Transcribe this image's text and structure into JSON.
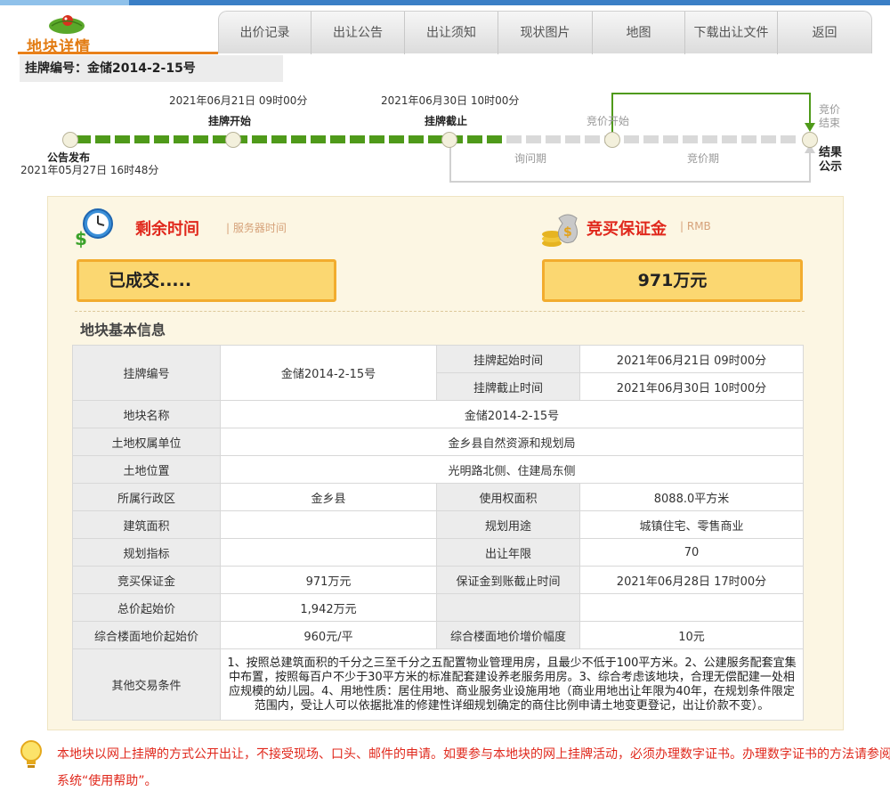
{
  "logo": {
    "text": "地块详情"
  },
  "nav": {
    "items": [
      {
        "label": "出价记录"
      },
      {
        "label": "出让公告"
      },
      {
        "label": "出让须知"
      },
      {
        "label": "现状图片"
      },
      {
        "label": "地图"
      },
      {
        "label": "下载出让文件"
      },
      {
        "label": "返回"
      }
    ]
  },
  "listing_code": "挂牌编号：金储2014-2-15号",
  "timeline": {
    "announce_label": "公告发布",
    "announce_time": "2021年05月27日 16时48分",
    "listing_start_time": "2021年06月21日 09时00分",
    "listing_start_label": "挂牌开始",
    "listing_end_time": "2021年06月30日 10时00分",
    "listing_end_label": "挂牌截止",
    "bidding_start_label": "竞价开始",
    "bidding_end_label": "竞价结束",
    "result_label": "结果公示",
    "inquiry_label": "询问期",
    "bidding_label": "竞价期",
    "progress_fraction": 0.5
  },
  "remaining": {
    "title": "剩余时间",
    "sub": "| 服务器时间",
    "value": "已成交....."
  },
  "deposit": {
    "title": "竞买保证金",
    "sub": "| RMB",
    "value": "971万元"
  },
  "info": {
    "title": "地块基本信息",
    "listing_no_label": "挂牌编号",
    "listing_no_value": "金储2014-2-15号",
    "start_time_label": "挂牌起始时间",
    "start_time_value": "2021年06月21日 09时00分",
    "end_time_label": "挂牌截止时间",
    "end_time_value": "2021年06月30日 10时00分",
    "name_label": "地块名称",
    "name_value": "金储2014-2-15号",
    "owner_label": "土地权属单位",
    "owner_value": "金乡县自然资源和规划局",
    "location_label": "土地位置",
    "location_value": "光明路北侧、住建局东侧",
    "district_label": "所属行政区",
    "district_value": "金乡县",
    "area_label": "使用权面积",
    "area_value": "8088.0平方米",
    "build_area_label": "建筑面积",
    "build_area_value": "",
    "usage_label": "规划用途",
    "usage_value": "城镇住宅、零售商业",
    "index_label": "规划指标",
    "index_value": "",
    "years_label": "出让年限",
    "years_value": "70",
    "deposit_label": "竞买保证金",
    "deposit_value": "971万元",
    "deposit_deadline_label": "保证金到账截止时间",
    "deposit_deadline_value": "2021年06月28日 17时00分",
    "start_price_label": "总价起始价",
    "start_price_value": "1,942万元",
    "floor_price_label": "综合楼面地价起始价",
    "floor_price_value": "960元/平",
    "increment_label": "综合楼面地价增价幅度",
    "increment_value": "10元",
    "other_label": "其他交易条件",
    "other_value": "1、按照总建筑面积的千分之三至千分之五配置物业管理用房，且最少不低于100平方米。2、公建服务配套宜集中布置，按照每百户不少于30平方米的标准配套建设养老服务用房。3、综合考虑该地块，合理无偿配建一处相应规模的幼儿园。4、用地性质：居住用地、商业服务业设施用地（商业用地出让年限为40年，在规划条件限定范围内，受让人可以依据批准的修建性详细规划确定的商住比例申请土地变更登记，出让价款不变）。"
  },
  "notice": "本地块以网上挂牌的方式公开出让，不接受现场、口头、邮件的申请。如要参与本地块的网上挂牌活动，必须办理数字证书。办理数字证书的方法请参阅本系统“使用帮助”。",
  "colors": {
    "accent": "#e0281c",
    "progress": "#4f9a1a",
    "box": "#fbd771"
  }
}
